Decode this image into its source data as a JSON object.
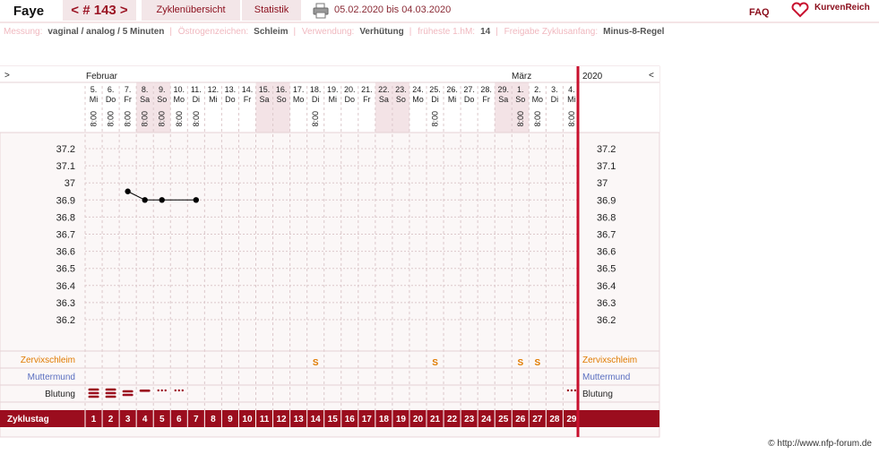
{
  "header": {
    "name": "Faye",
    "cycle_label": "< # 143 >",
    "overview_label": "Zyklenübersicht",
    "stats_label": "Statistik",
    "date_range": "05.02.2020 bis 04.03.2020",
    "faq_label": "FAQ",
    "brand": "KurvenReich",
    "print_icon": "printer-icon",
    "brand_icon": "heart-logo-icon"
  },
  "info": {
    "messung_label": "Messung:",
    "messung_value": "vaginal / analog / 5 Minuten",
    "oestrogen_label": "Östrogenzeichen:",
    "oestrogen_value": "Schleim",
    "verwendung_label": "Verwendung:",
    "verwendung_value": "Verhütung",
    "frueheste_label": "früheste 1.hM:",
    "frueheste_value": "14",
    "freigabe_label": "Freigabe Zyklusanfang:",
    "freigabe_value": "Minus-8-Regel"
  },
  "nav": {
    "left": ">",
    "right": "<",
    "year": "2020"
  },
  "months": {
    "first": "Februar",
    "second": "März"
  },
  "rows": {
    "zervix": "Zervixschleim",
    "muttermund": "Muttermund",
    "blutung": "Blutung",
    "zyklustag": "Zyklustag"
  },
  "copyright": "© http://www.nfp-forum.de",
  "colors": {
    "accent": "#9b0d1e",
    "weekend": "#f3e3e6",
    "zervix": "#e07b00",
    "muttermund": "#5a6fc0"
  },
  "chart_data": {
    "type": "line",
    "x_dates": [
      "5.",
      "6.",
      "7.",
      "8.",
      "9.",
      "10.",
      "11.",
      "12.",
      "13.",
      "14.",
      "15.",
      "16.",
      "17.",
      "18.",
      "19.",
      "20.",
      "21.",
      "22.",
      "23.",
      "24.",
      "25.",
      "26.",
      "27.",
      "28.",
      "29.",
      "1.",
      "2.",
      "3.",
      "4."
    ],
    "x_weekdays": [
      "Mi",
      "Do",
      "Fr",
      "Sa",
      "So",
      "Mo",
      "Di",
      "Mi",
      "Do",
      "Fr",
      "Sa",
      "So",
      "Mo",
      "Di",
      "Mi",
      "Do",
      "Fr",
      "Sa",
      "So",
      "Mo",
      "Di",
      "Mi",
      "Do",
      "Fr",
      "Sa",
      "So",
      "Mo",
      "Di",
      "Mi"
    ],
    "weekend_flags": [
      0,
      0,
      0,
      1,
      1,
      0,
      0,
      0,
      0,
      0,
      1,
      1,
      0,
      0,
      0,
      0,
      0,
      1,
      1,
      0,
      0,
      0,
      0,
      0,
      1,
      1,
      0,
      0,
      0
    ],
    "times": [
      "8:00",
      "8:00",
      "8:00",
      "8:00",
      "8:00",
      "8:00",
      "8:00",
      "",
      "",
      "",
      "",
      "",
      "",
      "8:00",
      "",
      "",
      "",
      "",
      "",
      "",
      "8:00",
      "",
      "",
      "",
      "",
      "8:00",
      "8:00",
      "",
      "8:00"
    ],
    "cycle_days": [
      "1",
      "2",
      "3",
      "4",
      "5",
      "6",
      "7",
      "8",
      "9",
      "10",
      "11",
      "12",
      "13",
      "14",
      "15",
      "16",
      "17",
      "18",
      "19",
      "20",
      "21",
      "22",
      "23",
      "24",
      "25",
      "26",
      "27",
      "28",
      "29"
    ],
    "y_ticks": [
      "37.2",
      "37.1",
      "37",
      "36.9",
      "36.8",
      "36.7",
      "36.6",
      "36.5",
      "36.4",
      "36.3",
      "36.2"
    ],
    "ylim": [
      36.2,
      37.2
    ],
    "series": [
      {
        "values": [
          null,
          null,
          36.95,
          36.9,
          36.9,
          null,
          36.9,
          null,
          null,
          null,
          null,
          null,
          null,
          null,
          null,
          null,
          null,
          null,
          null,
          null,
          null,
          null,
          null,
          null,
          null,
          null,
          null,
          null,
          null
        ]
      }
    ],
    "temp_connections": [
      [
        2,
        3
      ],
      [
        3,
        4
      ],
      [
        4,
        6
      ]
    ],
    "zervix": [
      "",
      "",
      "",
      "",
      "",
      "",
      "",
      "",
      "",
      "",
      "",
      "",
      "",
      "S",
      "",
      "",
      "",
      "",
      "",
      "",
      "S",
      "",
      "",
      "",
      "",
      "S",
      "S",
      "",
      ""
    ],
    "bleeding": [
      "heavy",
      "heavy",
      "medium",
      "light",
      "spot",
      "spot",
      "",
      "",
      "",
      "",
      "",
      "",
      "",
      "",
      "",
      "",
      "",
      "",
      "",
      "",
      "",
      "",
      "",
      "",
      "",
      "",
      "",
      "",
      "spot"
    ]
  }
}
